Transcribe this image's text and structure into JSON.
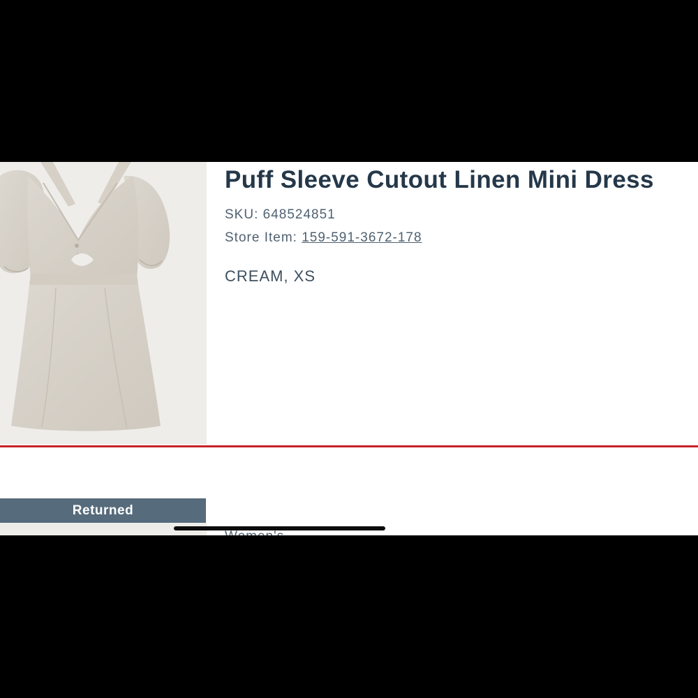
{
  "product": {
    "title": "Puff Sleeve Cutout Linen Mini Dress",
    "sku_label": "SKU:",
    "sku_value": "648524851",
    "store_item_label": "Store Item:",
    "store_item_value": "159-591-3672-178",
    "variant": "CREAM, XS",
    "image_icon": "dress-photo"
  },
  "status": {
    "label": "Returned"
  },
  "next_item": {
    "category_partial": "Women's"
  },
  "colors": {
    "title": "#25384a",
    "text": "#4f6170",
    "divider": "#c62127",
    "badge_bg": "#566b7c",
    "image_bg": "#efedea"
  }
}
